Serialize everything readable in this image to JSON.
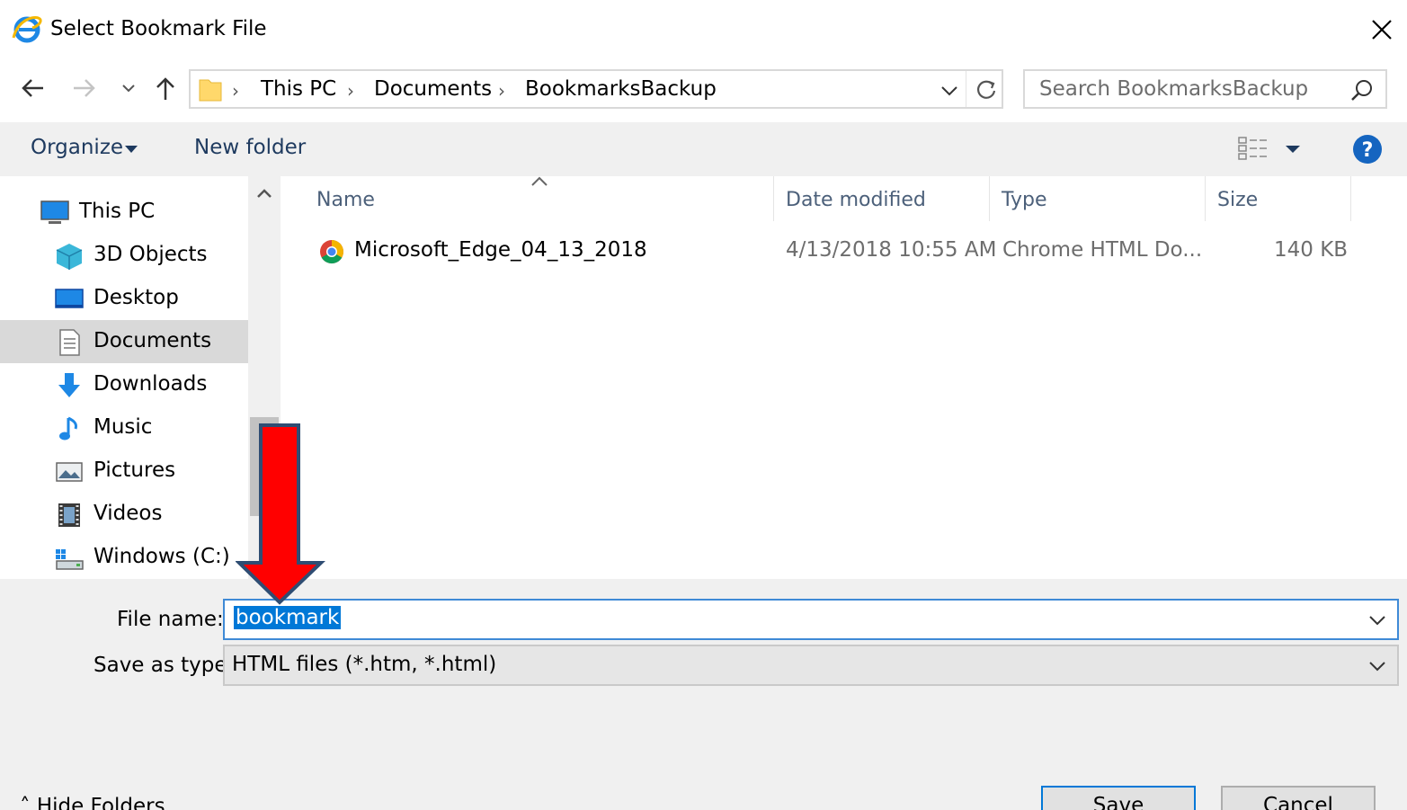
{
  "window": {
    "title": "Select Bookmark File",
    "close_label": "Close"
  },
  "navigation": {
    "breadcrumbs": [
      "This PC",
      "Documents",
      "BookmarksBackup"
    ],
    "search_placeholder": "Search BookmarksBackup"
  },
  "toolbar": {
    "organize_label": "Organize",
    "new_folder_label": "New folder"
  },
  "sidebar": {
    "items": [
      {
        "label": "This PC",
        "icon": "computer-icon"
      },
      {
        "label": "3D Objects",
        "icon": "3d-objects-icon"
      },
      {
        "label": "Desktop",
        "icon": "desktop-icon"
      },
      {
        "label": "Documents",
        "icon": "documents-icon",
        "selected": true
      },
      {
        "label": "Downloads",
        "icon": "downloads-icon"
      },
      {
        "label": "Music",
        "icon": "music-icon"
      },
      {
        "label": "Pictures",
        "icon": "pictures-icon"
      },
      {
        "label": "Videos",
        "icon": "videos-icon"
      },
      {
        "label": "Windows (C:)",
        "icon": "drive-icon"
      }
    ]
  },
  "file_list": {
    "columns": [
      "Name",
      "Date modified",
      "Type",
      "Size"
    ],
    "rows": [
      {
        "name": "Microsoft_Edge_04_13_2018",
        "date": "4/13/2018 10:55 AM",
        "type": "Chrome HTML Do...",
        "size": "140 KB",
        "icon": "chrome-icon"
      }
    ]
  },
  "save_form": {
    "file_name_label": "File name:",
    "file_name_value": "bookmark",
    "save_type_label": "Save as type:",
    "save_type_value": "HTML files (*.htm, *.html)",
    "hide_folders_label": "Hide Folders",
    "save_label": "Save",
    "cancel_label": "Cancel"
  },
  "colors": {
    "accent": "#0078d7",
    "annotation_arrow": "#ff0000",
    "annotation_arrow_outline": "#2f4d73"
  }
}
